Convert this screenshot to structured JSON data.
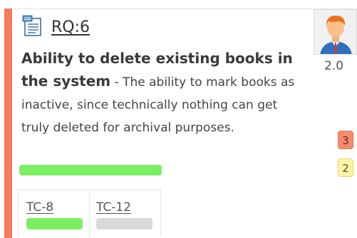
{
  "requirement": {
    "id": "RQ:6",
    "title": "Ability to delete existing books in the system",
    "separator": " - ",
    "description": "The ability to mark books as inactive, since technically nothing can get truly deleted for archival purposes.",
    "progress_fraction": 1.0,
    "progress_color": "#7cee62"
  },
  "owner": {
    "avatar_icon": "person-avatar-icon",
    "version": "2.0"
  },
  "badges": [
    {
      "value": "3",
      "color": "#f58a6c"
    },
    {
      "value": "2",
      "color": "#fff4a8"
    }
  ],
  "tests": [
    {
      "id": "TC-8",
      "status_fraction": 1.0,
      "status_color": "#7cee62"
    },
    {
      "id": "TC-12",
      "status_fraction": 0.0,
      "status_color": "#d9d9d9"
    }
  ],
  "colors": {
    "accent": "#f47b5c"
  }
}
